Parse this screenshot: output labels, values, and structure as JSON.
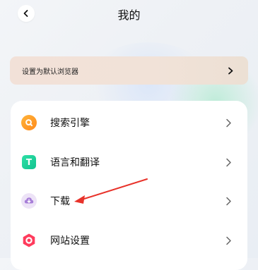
{
  "header": {
    "title": "我的",
    "back_icon": "chevron-left-icon"
  },
  "banner": {
    "label": "设置为默认浏览器",
    "arrow_icon": "chevron-right-icon"
  },
  "menu": {
    "items": [
      {
        "label": "搜索引擎",
        "icon": "search-engine-icon"
      },
      {
        "label": "语言和翻译",
        "icon": "translate-icon",
        "icon_text": "T"
      },
      {
        "label": "下载",
        "icon": "download-icon"
      },
      {
        "label": "网站设置",
        "icon": "site-settings-icon"
      }
    ]
  },
  "colors": {
    "annotation_arrow": "#e8322a",
    "search_icon": "#ff9a2a",
    "translate_icon": "#18cc96",
    "download_icon": "#a77ed8",
    "site_icon": "#ff3b5c"
  }
}
